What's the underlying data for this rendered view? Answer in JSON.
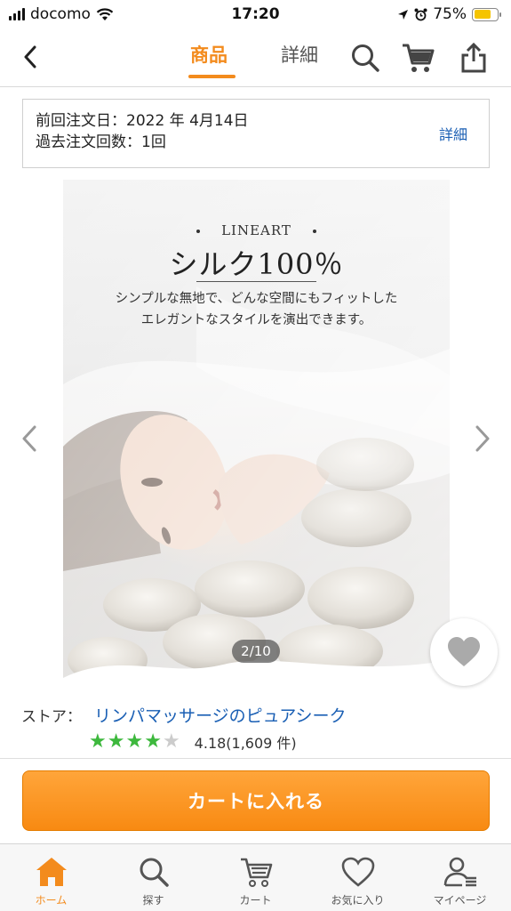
{
  "status_bar": {
    "carrier": "docomo",
    "time": "17:20",
    "battery": "75%",
    "battery_level": 0.75
  },
  "header": {
    "tabs": [
      {
        "label": "商品",
        "active": true
      },
      {
        "label": "詳細",
        "active": false
      }
    ]
  },
  "order_info": {
    "last_order_date": "前回注文日：2022 年 4月14日",
    "order_count": "過去注文回数：1回",
    "link": "詳細"
  },
  "product_image": {
    "brand": "LINEART",
    "headline": "シルク100％",
    "copy_line1": "シンプルな無地で、どんな空間にもフィットした",
    "copy_line2": "エレガントなスタイルを演出できます。",
    "counter": "2/10"
  },
  "store": {
    "label": "ストア：",
    "name": "リンパマッサージのピュアシーク",
    "rating": "4.18(1,609 件)",
    "stars": 4.18
  },
  "cart_button": {
    "label": "カートに入れる"
  },
  "bottom_nav": [
    {
      "label": "ホーム",
      "icon": "home-icon",
      "active": true
    },
    {
      "label": "探す",
      "icon": "search-icon",
      "active": false
    },
    {
      "label": "カート",
      "icon": "cart-icon",
      "active": false
    },
    {
      "label": "お気に入り",
      "icon": "heart-icon",
      "active": false
    },
    {
      "label": "マイページ",
      "icon": "user-icon",
      "active": false
    }
  ],
  "colors": {
    "accent": "#f38b1d",
    "link": "#1a5fb4",
    "star": "#3db83d",
    "star_empty": "#cccccc"
  }
}
